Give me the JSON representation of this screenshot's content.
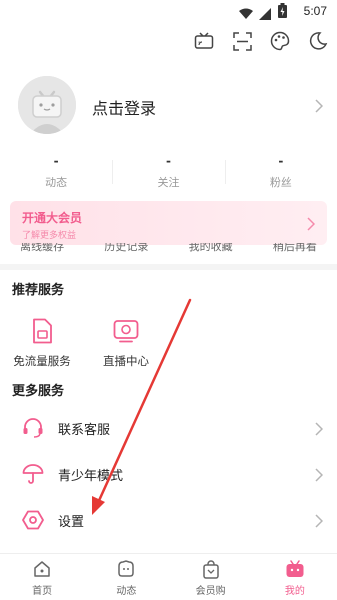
{
  "status": {
    "time": "5:07"
  },
  "profile": {
    "login_label": "点击登录"
  },
  "stats": [
    {
      "value": "-",
      "label": "动态"
    },
    {
      "value": "-",
      "label": "关注"
    },
    {
      "value": "-",
      "label": "粉丝"
    }
  ],
  "vip": {
    "title": "开通大会员",
    "subtitle": "了解更多权益"
  },
  "shortcuts": [
    "离线缓存",
    "历史记录",
    "我的收藏",
    "稍后再看"
  ],
  "recommended": {
    "title": "推荐服务",
    "items": [
      {
        "label": "免流量服务",
        "icon": "sim-card-icon"
      },
      {
        "label": "直播中心",
        "icon": "live-tv-icon"
      }
    ]
  },
  "more": {
    "title": "更多服务",
    "items": [
      {
        "label": "联系客服",
        "icon": "headset-icon"
      },
      {
        "label": "青少年模式",
        "icon": "umbrella-icon"
      },
      {
        "label": "设置",
        "icon": "gear-icon"
      }
    ]
  },
  "tabs": [
    {
      "label": "首页",
      "icon": "home-icon"
    },
    {
      "label": "动态",
      "icon": "feed-icon"
    },
    {
      "label": "会员购",
      "icon": "shop-bag-icon"
    },
    {
      "label": "我的",
      "icon": "tv-mascot-icon"
    }
  ],
  "colors": {
    "accent": "#f25d8e",
    "arrow": "#e53935",
    "vip_bg": "#ffe6ec"
  }
}
